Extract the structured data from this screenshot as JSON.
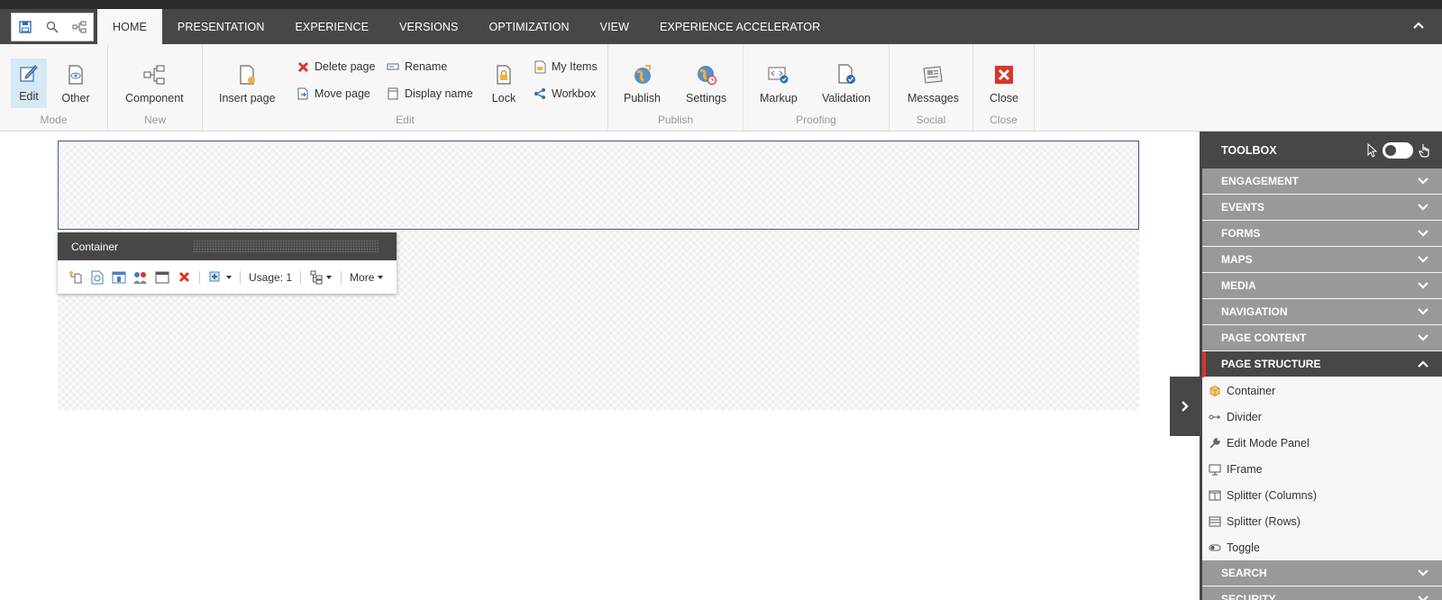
{
  "tabs": [
    {
      "label": "HOME",
      "active": true
    },
    {
      "label": "PRESENTATION"
    },
    {
      "label": "EXPERIENCE"
    },
    {
      "label": "VERSIONS"
    },
    {
      "label": "OPTIMIZATION"
    },
    {
      "label": "VIEW"
    },
    {
      "label": "EXPERIENCE ACCELERATOR"
    }
  ],
  "quick_access": [
    "save-icon",
    "search-icon",
    "tree-icon"
  ],
  "ribbon": {
    "mode": {
      "label": "Mode",
      "edit": "Edit",
      "other": "Other"
    },
    "new": {
      "label": "New",
      "component": "Component"
    },
    "edit": {
      "label": "Edit",
      "insert_page": "Insert page",
      "delete_page": "Delete page",
      "move_page": "Move page",
      "rename": "Rename",
      "display_name": "Display name",
      "lock": "Lock",
      "my_items": "My Items",
      "workbox": "Workbox"
    },
    "publish": {
      "label": "Publish",
      "publish": "Publish",
      "settings": "Settings"
    },
    "proofing": {
      "label": "Proofing",
      "markup": "Markup",
      "validation": "Validation"
    },
    "social": {
      "label": "Social",
      "messages": "Messages"
    },
    "close": {
      "label": "Close",
      "close": "Close"
    }
  },
  "chrome": {
    "title": "Container",
    "usage": "Usage: 1",
    "more": "More"
  },
  "toolbox": {
    "title": "TOOLBOX",
    "categories_before": [
      "ENGAGEMENT",
      "EVENTS",
      "FORMS",
      "MAPS",
      "MEDIA",
      "NAVIGATION",
      "PAGE CONTENT"
    ],
    "open_category": "PAGE STRUCTURE",
    "items": [
      "Container",
      "Divider",
      "Edit Mode Panel",
      "IFrame",
      "Splitter (Columns)",
      "Splitter (Rows)",
      "Toggle"
    ],
    "categories_after": [
      "SEARCH",
      "SECURITY"
    ]
  },
  "colors": {
    "dark": "#474747",
    "accent_red": "#d9352a",
    "category_gray": "#999999",
    "active_blue": "#d7e8f5"
  }
}
